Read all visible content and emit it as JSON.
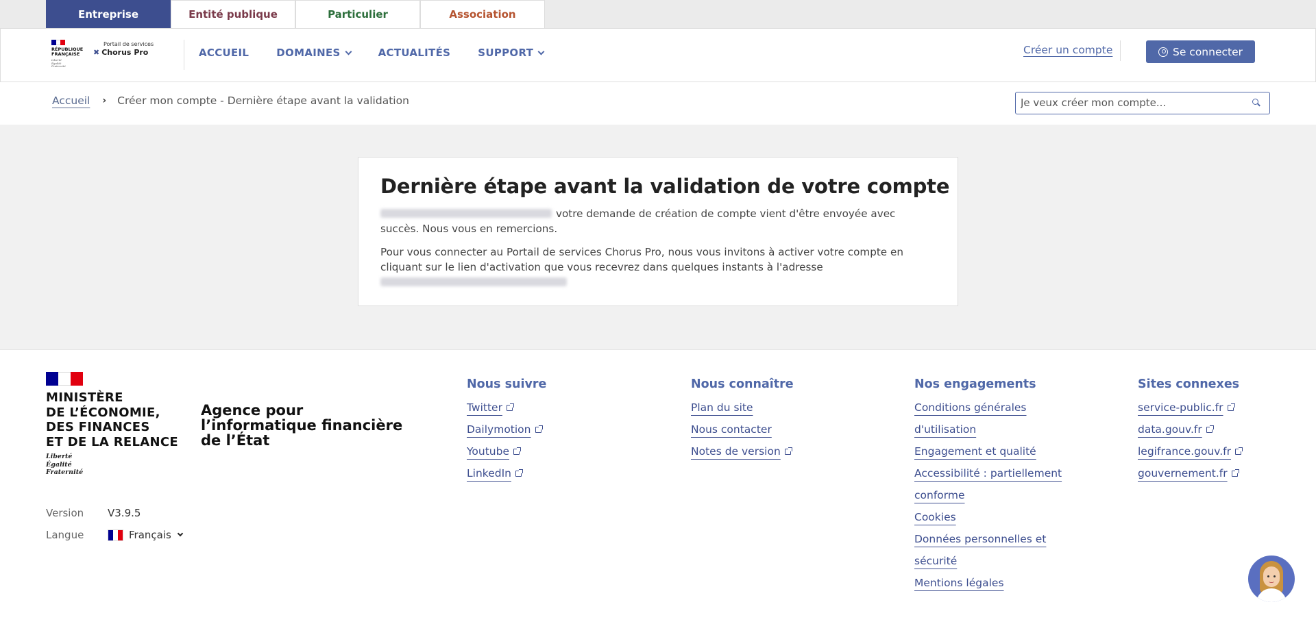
{
  "audience_tabs": [
    "Entreprise",
    "Entité publique",
    "Particulier",
    "Association"
  ],
  "active_audience_tab": "Entreprise",
  "logo": {
    "republic": "RÉPUBLIQUE FRANÇAISE",
    "motto": "Liberté Égalité Fraternité",
    "portal_label": "Portail de services",
    "brand": "Chorus Pro"
  },
  "nav": {
    "home": "ACCUEIL",
    "domains": "DOMAINES",
    "news": "ACTUALITÉS",
    "support": "SUPPORT"
  },
  "header": {
    "create_account": "Créer un compte",
    "login": "Se connecter"
  },
  "breadcrumb": {
    "home": "Accueil",
    "current": "Créer mon compte - Dernière étape avant la validation"
  },
  "search": {
    "value": "Je veux créer mon compte..."
  },
  "card": {
    "title": "Dernière étape avant la validation de votre compte",
    "paragraph1": "votre demande de création de compte vient d'être envoyée avec succès. Nous vous en remercions.",
    "paragraph2": "Pour vous connecter au Portail de services Chorus Pro, nous vous invitons à activer votre compte en cliquant sur le lien d'activation que vous recevrez dans quelques instants à l'adresse"
  },
  "footer": {
    "ministry": "MINISTÈRE DE L'ÉCONOMIE, DES FINANCES ET DE LA RELANCE",
    "ministry_lines": [
      "MINISTÈRE",
      "DE L’ÉCONOMIE,",
      "DES FINANCES",
      "ET DE LA RELANCE"
    ],
    "motto_lines": [
      "Liberté",
      "Égalité",
      "Fraternité"
    ],
    "agency": "Agence pour l’informatique financière de l’État",
    "version_label": "Version",
    "version_value": "V3.9.5",
    "language_label": "Langue",
    "language_value": "Français",
    "columns": [
      {
        "title": "Nous suivre",
        "links": [
          {
            "label": "Twitter",
            "external": true
          },
          {
            "label": "Dailymotion",
            "external": true
          },
          {
            "label": "Youtube",
            "external": true
          },
          {
            "label": "LinkedIn",
            "external": true
          }
        ]
      },
      {
        "title": "Nous connaître",
        "links": [
          {
            "label": "Plan du site",
            "external": false
          },
          {
            "label": "Nous contacter",
            "external": false
          },
          {
            "label": "Notes de version",
            "external": true
          }
        ]
      },
      {
        "title": "Nos engagements",
        "links": [
          {
            "label": "Conditions générales d'utilisation",
            "external": false
          },
          {
            "label": "Engagement et qualité",
            "external": false
          },
          {
            "label": "Accessibilité : partiellement conforme",
            "external": false
          },
          {
            "label": "Cookies",
            "external": false
          },
          {
            "label": "Données personnelles et sécurité",
            "external": false
          },
          {
            "label": "Mentions légales",
            "external": false
          }
        ]
      },
      {
        "title": "Sites connexes",
        "links": [
          {
            "label": "service-public.fr",
            "external": true
          },
          {
            "label": "data.gouv.fr",
            "external": true
          },
          {
            "label": "legifrance.gouv.fr",
            "external": true
          },
          {
            "label": "gouvernement.fr",
            "external": true
          }
        ]
      }
    ]
  },
  "colors": {
    "primary": "#3d4e8f",
    "link": "#5068a8",
    "flag_blue": "#000091",
    "flag_white": "#ffffff",
    "flag_red": "#e1000f"
  }
}
